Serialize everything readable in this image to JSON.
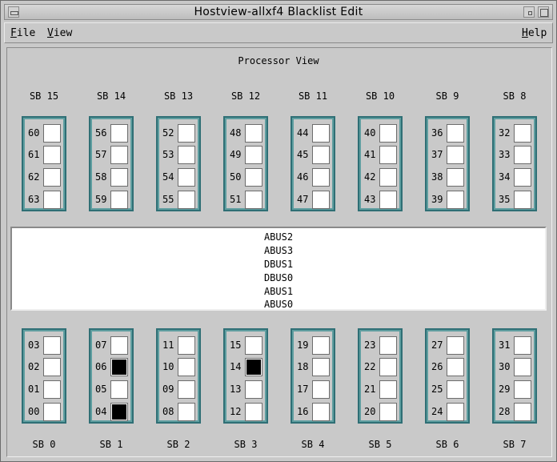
{
  "window": {
    "title": "Hostview-allxf4 Blacklist Edit"
  },
  "menubar": {
    "file": {
      "mnemonic": "F",
      "rest": "ile"
    },
    "view": {
      "mnemonic": "V",
      "rest": "iew"
    },
    "help": {
      "mnemonic": "H",
      "rest": "elp"
    }
  },
  "panel": {
    "title": "Processor View"
  },
  "top_boards": [
    {
      "label": "SB 15",
      "slots": [
        {
          "num": "60",
          "on": false
        },
        {
          "num": "61",
          "on": false
        },
        {
          "num": "62",
          "on": false
        },
        {
          "num": "63",
          "on": false
        }
      ]
    },
    {
      "label": "SB 14",
      "slots": [
        {
          "num": "56",
          "on": false
        },
        {
          "num": "57",
          "on": false
        },
        {
          "num": "58",
          "on": false
        },
        {
          "num": "59",
          "on": false
        }
      ]
    },
    {
      "label": "SB 13",
      "slots": [
        {
          "num": "52",
          "on": false
        },
        {
          "num": "53",
          "on": false
        },
        {
          "num": "54",
          "on": false
        },
        {
          "num": "55",
          "on": false
        }
      ]
    },
    {
      "label": "SB 12",
      "slots": [
        {
          "num": "48",
          "on": false
        },
        {
          "num": "49",
          "on": false
        },
        {
          "num": "50",
          "on": false
        },
        {
          "num": "51",
          "on": false
        }
      ]
    },
    {
      "label": "SB 11",
      "slots": [
        {
          "num": "44",
          "on": false
        },
        {
          "num": "45",
          "on": false
        },
        {
          "num": "46",
          "on": false
        },
        {
          "num": "47",
          "on": false
        }
      ]
    },
    {
      "label": "SB 10",
      "slots": [
        {
          "num": "40",
          "on": false
        },
        {
          "num": "41",
          "on": false
        },
        {
          "num": "42",
          "on": false
        },
        {
          "num": "43",
          "on": false
        }
      ]
    },
    {
      "label": "SB 9",
      "slots": [
        {
          "num": "36",
          "on": false
        },
        {
          "num": "37",
          "on": false
        },
        {
          "num": "38",
          "on": false
        },
        {
          "num": "39",
          "on": false
        }
      ]
    },
    {
      "label": "SB 8",
      "slots": [
        {
          "num": "32",
          "on": false
        },
        {
          "num": "33",
          "on": false
        },
        {
          "num": "34",
          "on": false
        },
        {
          "num": "35",
          "on": false
        }
      ]
    }
  ],
  "bus_list": [
    "ABUS2",
    "ABUS3",
    "DBUS1",
    "DBUS0",
    "ABUS1",
    "ABUS0"
  ],
  "bottom_boards": [
    {
      "label": "SB 0",
      "slots": [
        {
          "num": "03",
          "on": false
        },
        {
          "num": "02",
          "on": false
        },
        {
          "num": "01",
          "on": false
        },
        {
          "num": "00",
          "on": false
        }
      ]
    },
    {
      "label": "SB 1",
      "slots": [
        {
          "num": "07",
          "on": false
        },
        {
          "num": "06",
          "on": true
        },
        {
          "num": "05",
          "on": false
        },
        {
          "num": "04",
          "on": true
        }
      ]
    },
    {
      "label": "SB 2",
      "slots": [
        {
          "num": "11",
          "on": false
        },
        {
          "num": "10",
          "on": false
        },
        {
          "num": "09",
          "on": false
        },
        {
          "num": "08",
          "on": false
        }
      ]
    },
    {
      "label": "SB 3",
      "slots": [
        {
          "num": "15",
          "on": false
        },
        {
          "num": "14",
          "on": true
        },
        {
          "num": "13",
          "on": false
        },
        {
          "num": "12",
          "on": false
        }
      ]
    },
    {
      "label": "SB 4",
      "slots": [
        {
          "num": "19",
          "on": false
        },
        {
          "num": "18",
          "on": false
        },
        {
          "num": "17",
          "on": false
        },
        {
          "num": "16",
          "on": false
        }
      ]
    },
    {
      "label": "SB 5",
      "slots": [
        {
          "num": "23",
          "on": false
        },
        {
          "num": "22",
          "on": false
        },
        {
          "num": "21",
          "on": false
        },
        {
          "num": "20",
          "on": false
        }
      ]
    },
    {
      "label": "SB 6",
      "slots": [
        {
          "num": "27",
          "on": false
        },
        {
          "num": "26",
          "on": false
        },
        {
          "num": "25",
          "on": false
        },
        {
          "num": "24",
          "on": false
        }
      ]
    },
    {
      "label": "SB 7",
      "slots": [
        {
          "num": "31",
          "on": false
        },
        {
          "num": "30",
          "on": false
        },
        {
          "num": "29",
          "on": false
        },
        {
          "num": "28",
          "on": false
        }
      ]
    }
  ]
}
